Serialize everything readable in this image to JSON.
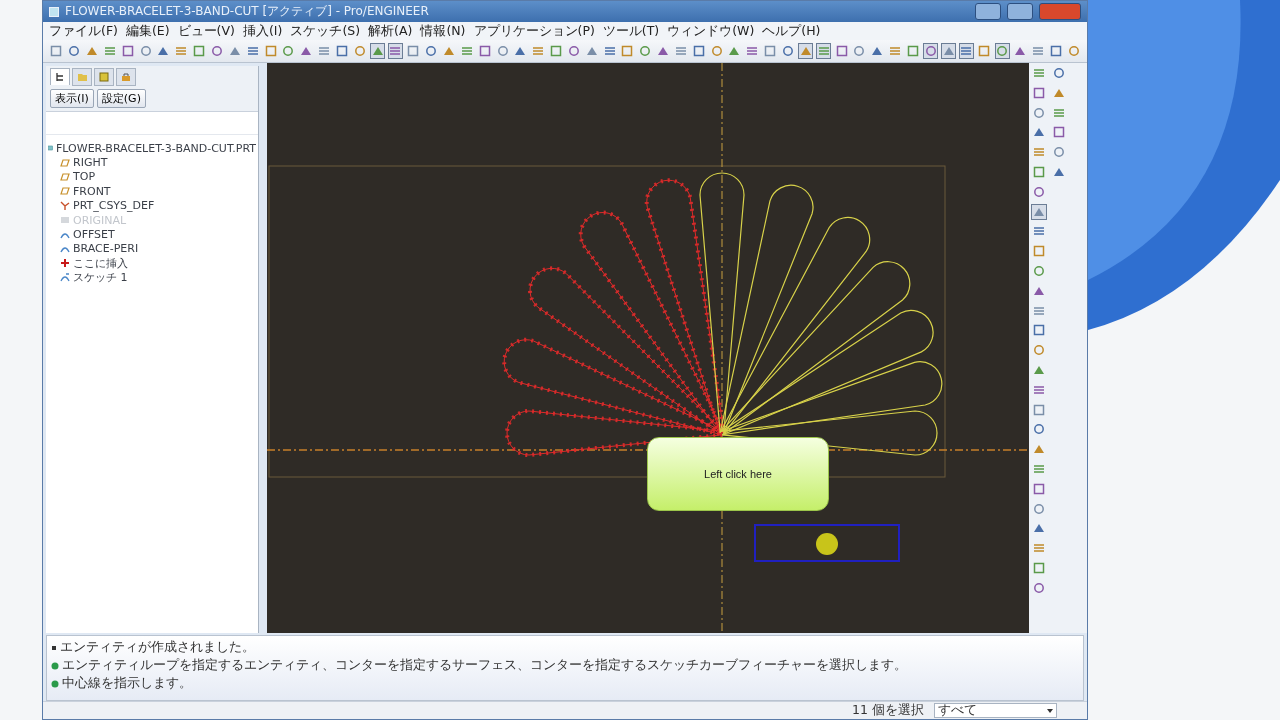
{
  "window": {
    "title": "FLOWER-BRACELET-3-BAND-CUT [アクティブ] - Pro/ENGINEER"
  },
  "menu": [
    "ファイル(F)",
    "編集(E)",
    "ビュー(V)",
    "挿入(I)",
    "スケッチ(S)",
    "解析(A)",
    "情報(N)",
    "アプリケーション(P)",
    "ツール(T)",
    "ウィンドウ(W)",
    "ヘルプ(H)"
  ],
  "model_tree": {
    "tabs": [
      {
        "kind": "tree",
        "selected": true
      },
      {
        "kind": "folder",
        "selected": false
      },
      {
        "kind": "layer",
        "selected": false
      },
      {
        "kind": "lock",
        "selected": false
      }
    ],
    "buttons": [
      "表示(I)",
      "設定(G)"
    ],
    "items": [
      {
        "label": "FLOWER-BRACELET-3-BAND-CUT.PRT",
        "kind": "part",
        "disabled": false,
        "children": [
          {
            "label": "RIGHT",
            "kind": "plane",
            "disabled": false
          },
          {
            "label": "TOP",
            "kind": "plane",
            "disabled": false
          },
          {
            "label": "FRONT",
            "kind": "plane",
            "disabled": false
          },
          {
            "label": "PRT_CSYS_DEF",
            "kind": "csys",
            "disabled": false
          },
          {
            "label": "ORIGINAL",
            "kind": "feature",
            "disabled": true
          },
          {
            "label": "OFFSET",
            "kind": "curve",
            "disabled": false
          },
          {
            "label": "BRACE-PERI",
            "kind": "curve",
            "disabled": false
          },
          {
            "label": "ここに挿入",
            "kind": "insert",
            "disabled": false
          },
          {
            "label": "スケッチ 1",
            "kind": "sketch",
            "disabled": false
          }
        ]
      }
    ]
  },
  "callout": {
    "text": "Left click here"
  },
  "messages": [
    {
      "kind": "info",
      "text": "エンティティが作成されました。"
    },
    {
      "kind": "prompt",
      "text": "エンティティループを指定するエンティティ、コンターを指定するサーフェス、コンターを指定するスケッチカーブフィーチャーを選択します。"
    },
    {
      "kind": "prompt",
      "text": "中心線を指示します。"
    }
  ],
  "status_bar": {
    "selection": "11 個を選択",
    "filter": "すべて"
  }
}
